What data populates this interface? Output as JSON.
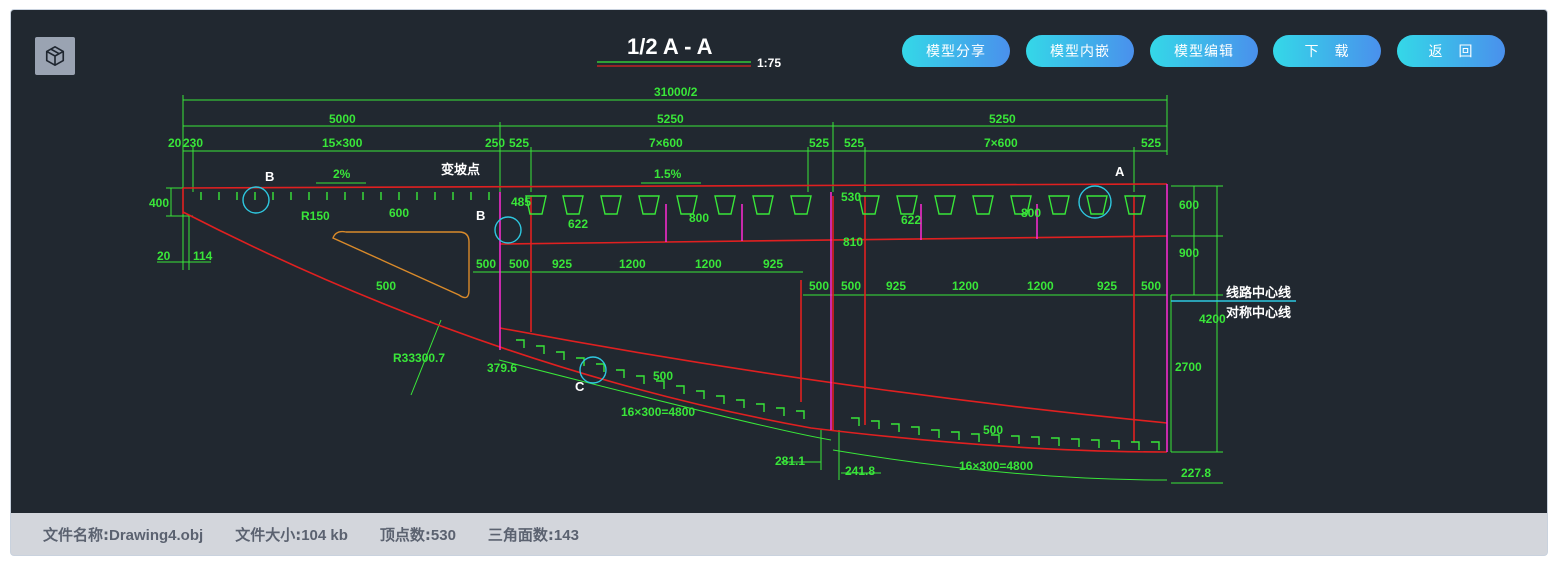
{
  "drawing": {
    "title": "1/2 A - A",
    "scale": "1:75",
    "dims": {
      "total": "31000/2",
      "d5000": "5000",
      "d5250a": "5250",
      "d5250b": "5250",
      "d20": "20",
      "d230": "230",
      "d15x300": "15×300",
      "d250": "250",
      "d525a": "525",
      "d7x600a": "7×600",
      "d525b": "525",
      "d525c": "525",
      "d7x600b": "7×600",
      "d525d": "525",
      "d400": "400",
      "d20b": "20",
      "d114": "114",
      "d600a": "600",
      "d485": "485",
      "d622a": "622",
      "d800a": "800",
      "d530": "530",
      "d622b": "622",
      "d800b": "800",
      "d810": "810",
      "d600r": "600",
      "d900r": "900",
      "d4200": "4200",
      "d2700": "2700",
      "d227": "227.8",
      "r150": "R150",
      "r33300": "R33300.7",
      "d500a": "500",
      "d500b": "500",
      "d500c": "500",
      "d925a": "925",
      "d1200a": "1200",
      "d1200b": "1200",
      "d925b": "925",
      "d500d": "500",
      "d500e": "500",
      "d925c": "925",
      "d1200c": "1200",
      "d1200d": "1200",
      "d925d": "925",
      "d500f": "500",
      "d379": "379.6",
      "d500g": "500",
      "d16x300a": "16×300=4800",
      "d500h": "500",
      "d281": "281.1",
      "d241": "241.8",
      "d16x300b": "16×300=4800"
    },
    "slope_left": "2%",
    "slope_right": "1.5%",
    "change_point": "变坡点",
    "marks": {
      "a": "A",
      "b1": "B",
      "b2": "B",
      "c": "C"
    },
    "route_center": "线路中心线",
    "sym_center": "对称中心线"
  },
  "actions": [
    "模型分享",
    "模型内嵌",
    "模型编辑",
    "下　载",
    "返　回"
  ],
  "footer": {
    "name_label": "文件名称:",
    "name_value": "Drawing4.obj",
    "size_label": "文件大小:",
    "size_value": "104 kb",
    "verts_label": "顶点数:",
    "verts_value": "530",
    "faces_label": "三角面数:",
    "faces_value": "143"
  }
}
